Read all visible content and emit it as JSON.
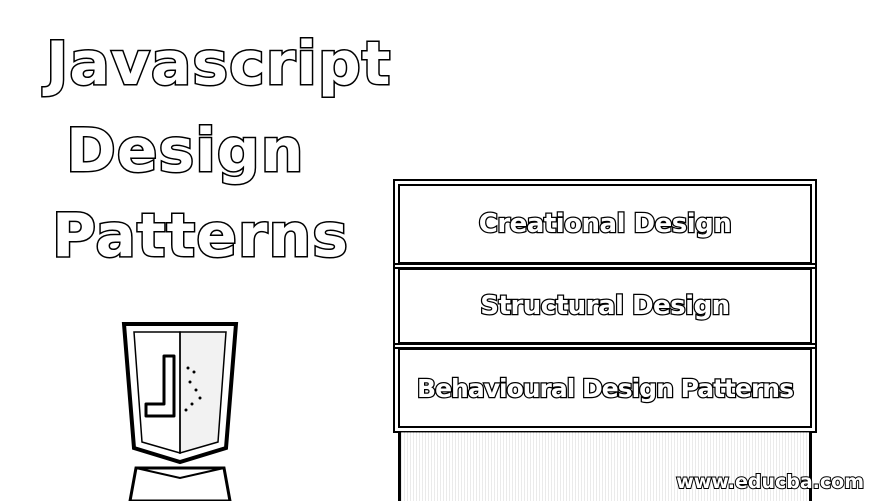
{
  "title": {
    "line1": "Javascript",
    "line2": "Design",
    "line3": "Patterns"
  },
  "categories": [
    {
      "label": "Creational Design"
    },
    {
      "label": "Structural Design"
    },
    {
      "label": "Behavioural Design Patterns"
    }
  ],
  "watermark": "www.educba.com",
  "logo": {
    "icon": "javascript-shield-icon",
    "letter": "J"
  }
}
